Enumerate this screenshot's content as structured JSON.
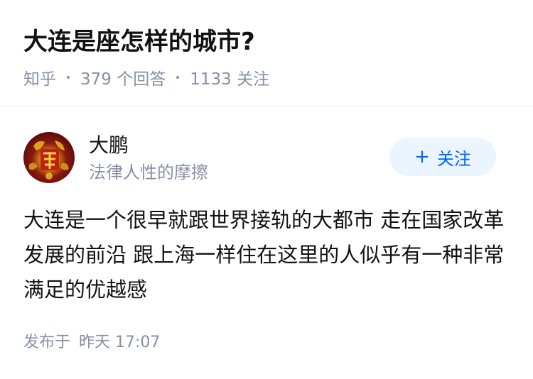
{
  "question": {
    "title": "大连是座怎样的城市?",
    "meta": {
      "source": "知乎",
      "answers": "379 个回答",
      "followers": "1133 关注"
    }
  },
  "answer": {
    "author": {
      "name": "大鹏",
      "bio": "法律人性的摩擦",
      "avatar_icon": "avatar-image"
    },
    "follow_button": {
      "icon": "plus-icon",
      "plus": "+",
      "label": "关注"
    },
    "content": "大连是一个很早就跟世界接轨的大都市 走在国家改革发展的前沿 跟上海一样住在这里的人似乎有一种非常满足的优越感",
    "time": {
      "prefix": "发布于",
      "value": "昨天 17:07"
    }
  },
  "colors": {
    "text_primary": "#121212",
    "text_secondary": "#8590a6",
    "accent": "#0066ff",
    "button_bg": "#ebf5ff"
  }
}
